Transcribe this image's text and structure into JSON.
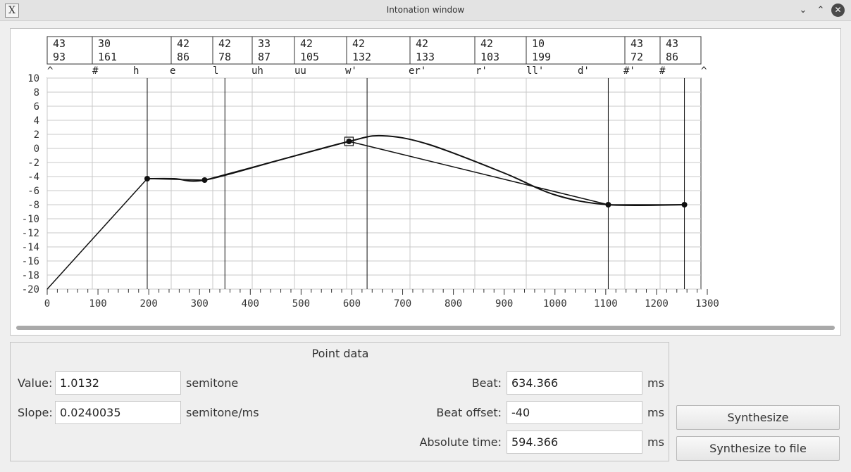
{
  "window": {
    "title": "Intonation window",
    "app_icon_glyph": "X"
  },
  "phonemes": [
    {
      "code": "^",
      "top": "43",
      "bottom": "93"
    },
    {
      "code": "#",
      "top": "30",
      "bottom": "161"
    },
    {
      "code": "h",
      "top": "42",
      "bottom": "86"
    },
    {
      "code": "e",
      "top": "42",
      "bottom": "78"
    },
    {
      "code": "l",
      "top": "33",
      "bottom": "87"
    },
    {
      "code": "uh",
      "top": "42",
      "bottom": "105"
    },
    {
      "code": "uu",
      "top": "42",
      "bottom": "132"
    },
    {
      "code": "w'",
      "top": "42",
      "bottom": "133"
    },
    {
      "code": "er'",
      "top": "42",
      "bottom": "103"
    },
    {
      "code": "r'",
      "top": "10",
      "bottom": "199"
    },
    {
      "code": "ll'",
      "top": "43",
      "bottom": "72"
    },
    {
      "code": "d'",
      "top": "43",
      "bottom": "86"
    },
    {
      "code": "#'",
      "top": "",
      "bottom": ""
    },
    {
      "code": "#",
      "top": "",
      "bottom": ""
    },
    {
      "code": "^",
      "top": "",
      "bottom": ""
    }
  ],
  "chart_data": {
    "type": "line",
    "xlim": [
      0,
      1300
    ],
    "ylim": [
      -20,
      10
    ],
    "x_ticks": [
      0,
      100,
      200,
      300,
      400,
      500,
      600,
      700,
      800,
      900,
      1000,
      1100,
      1200,
      1300
    ],
    "y_ticks": [
      10,
      8,
      6,
      4,
      2,
      0,
      -2,
      -4,
      -6,
      -8,
      -10,
      -12,
      -14,
      -16,
      -18,
      -20
    ],
    "grid": true,
    "points": [
      {
        "x": 197,
        "y": -4.3
      },
      {
        "x": 310,
        "y": -4.5
      },
      {
        "x": 594.4,
        "y": 1.0
      },
      {
        "x": 1105,
        "y": -8.0
      },
      {
        "x": 1255,
        "y": -8.0
      }
    ],
    "series": [
      {
        "values": [
          [
            0,
            -20
          ],
          [
            197,
            -4.3
          ],
          [
            310,
            -4.5
          ],
          [
            594.4,
            1.0
          ],
          [
            1105,
            -8.0
          ],
          [
            1255,
            -8.0
          ]
        ]
      },
      {
        "values": [
          [
            197,
            -4.3
          ],
          [
            250,
            -4.3
          ],
          [
            310,
            -4.5
          ],
          [
            450,
            -1.8
          ],
          [
            594.4,
            1.0
          ],
          [
            660,
            1.8
          ],
          [
            750,
            0.6
          ],
          [
            900,
            -3.5
          ],
          [
            1000,
            -6.6
          ],
          [
            1105,
            -8.0
          ],
          [
            1255,
            -8.0
          ]
        ]
      }
    ],
    "selected_point_x": 594.4,
    "rule_lines_x": [
      197,
      350,
      630,
      1105,
      1255
    ]
  },
  "point_data": {
    "title": "Point data",
    "value_label": "Value:",
    "value": "1.0132",
    "value_unit": "semitone",
    "slope_label": "Slope:",
    "slope": "0.0240035",
    "slope_unit": "semitone/ms",
    "beat_label": "Beat:",
    "beat": "634.366",
    "beat_unit": "ms",
    "beat_offset_label": "Beat offset:",
    "beat_offset": "-40",
    "beat_offset_unit": "ms",
    "absolute_time_label": "Absolute time:",
    "absolute_time": "594.366",
    "absolute_time_unit": "ms"
  },
  "buttons": {
    "synthesize": "Synthesize",
    "synthesize_to_file": "Synthesize to file"
  }
}
